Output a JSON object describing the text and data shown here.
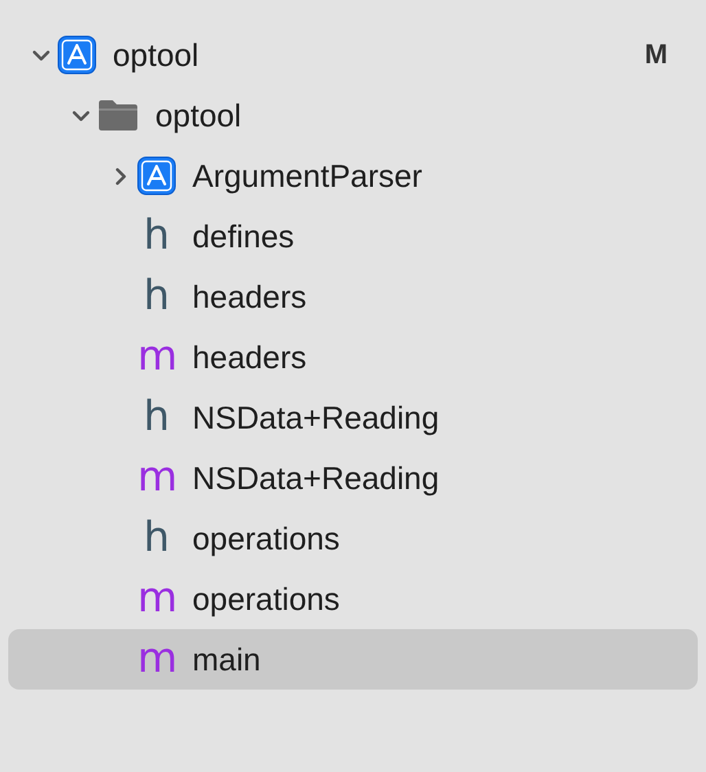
{
  "navigator": {
    "items": [
      {
        "kind": "project",
        "label": "optool",
        "status": "M",
        "expanded": true,
        "selected": false,
        "children": [
          {
            "kind": "folder",
            "label": "optool",
            "expanded": true,
            "selected": false,
            "children": [
              {
                "kind": "project",
                "label": "ArgumentParser",
                "expanded": false,
                "selected": false
              },
              {
                "kind": "header",
                "icon_text": "h",
                "label": "defines",
                "selected": false
              },
              {
                "kind": "header",
                "icon_text": "h",
                "label": "headers",
                "selected": false
              },
              {
                "kind": "source",
                "icon_text": "m",
                "label": "headers",
                "selected": false
              },
              {
                "kind": "header",
                "icon_text": "h",
                "label": "NSData+Reading",
                "selected": false
              },
              {
                "kind": "source",
                "icon_text": "m",
                "label": "NSData+Reading",
                "selected": false
              },
              {
                "kind": "header",
                "icon_text": "h",
                "label": "operations",
                "selected": false
              },
              {
                "kind": "source",
                "icon_text": "m",
                "label": "operations",
                "selected": false
              },
              {
                "kind": "source",
                "icon_text": "m",
                "label": "main",
                "selected": true
              }
            ]
          }
        ]
      }
    ]
  }
}
